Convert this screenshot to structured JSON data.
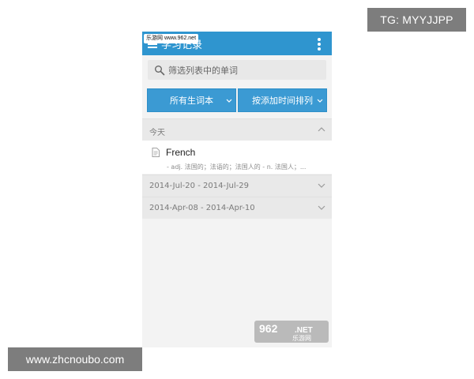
{
  "outer": {
    "tg_badge": "TG: MYYJJPP",
    "site_badge": "www.zhcnoubo.com"
  },
  "app": {
    "title": "学习记录",
    "url_overlay": "乐游网 www.962.net",
    "search_placeholder": "筛选列表中的单词",
    "filters": [
      {
        "label": "所有生词本"
      },
      {
        "label": "按添加时间排列"
      }
    ],
    "sections": [
      {
        "label": "今天",
        "expanded": true
      },
      {
        "label": "2014-Jul-20 - 2014-Jul-29",
        "expanded": false
      },
      {
        "label": "2014-Apr-08 - 2014-Apr-10",
        "expanded": false
      }
    ],
    "word": {
      "title": "French",
      "meaning": "- adj. 法国的；法语的；法国人的 - n. 法国人；..."
    },
    "brand_watermark": {
      "number": "962",
      "suffix": ".NET",
      "name": "乐游网"
    }
  },
  "icons": {
    "menu": "hamburger-icon",
    "more": "more-vertical-icon",
    "search": "search-icon",
    "dropdown": "chevron-down-icon",
    "collapse": "chevron-up-icon",
    "document": "document-icon"
  },
  "colors": {
    "appbar": "#2f95cf",
    "button": "#3b9ad3",
    "background": "#f3f3f3",
    "section": "#e9e9e9",
    "badge": "#7d7d7d"
  }
}
